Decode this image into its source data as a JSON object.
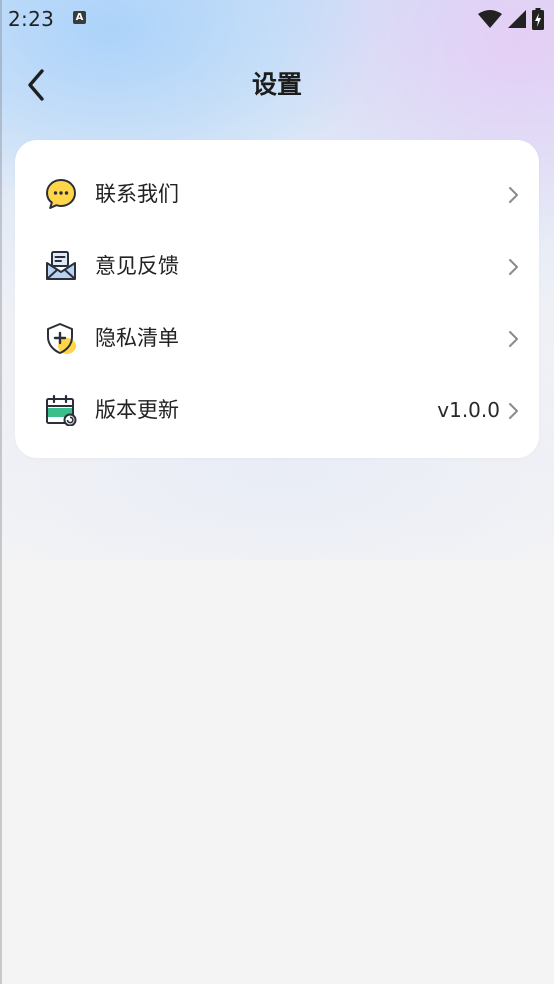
{
  "status_bar": {
    "time": "2:23",
    "notification_icon_letter": "A",
    "icons": [
      "wifi-icon",
      "cell-signal-icon",
      "battery-charging-icon"
    ]
  },
  "header": {
    "title": "设置",
    "back_icon": "chevron-left-icon"
  },
  "settings": {
    "items": [
      {
        "label": "联系我们",
        "icon": "chat-bubble-icon",
        "value": ""
      },
      {
        "label": "意见反馈",
        "icon": "feedback-envelope-icon",
        "value": ""
      },
      {
        "label": "隐私清单",
        "icon": "privacy-shield-icon",
        "value": ""
      },
      {
        "label": "版本更新",
        "icon": "calendar-update-icon",
        "value": "v1.0.0"
      }
    ]
  },
  "colors": {
    "accent_yellow": "#ffd54a",
    "accent_green": "#3bbf8a",
    "icon_outline": "#2b2f3a",
    "card_background": "#ffffff"
  }
}
